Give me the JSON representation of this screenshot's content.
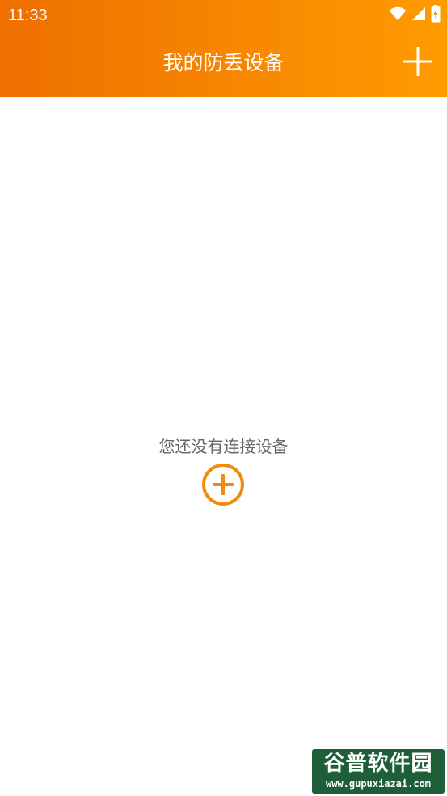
{
  "status_bar": {
    "time": "11:33",
    "icons": [
      "wifi-icon",
      "cell-signal-icon",
      "battery-charging-icon"
    ]
  },
  "app_bar": {
    "title": "我的防丢设备",
    "action_icon": "plus-icon"
  },
  "empty_state": {
    "message": "您还没有连接设备",
    "action_icon": "add-circle-icon"
  },
  "watermark": {
    "title": "谷普软件园",
    "url": "www.gupuxiazai.com"
  },
  "colors": {
    "app_bar_gradient_start": "#EE6F00",
    "app_bar_gradient_end": "#FF9B00",
    "accent": "#F28A0F",
    "empty_text": "#666666",
    "background": "#FFFFFF"
  }
}
